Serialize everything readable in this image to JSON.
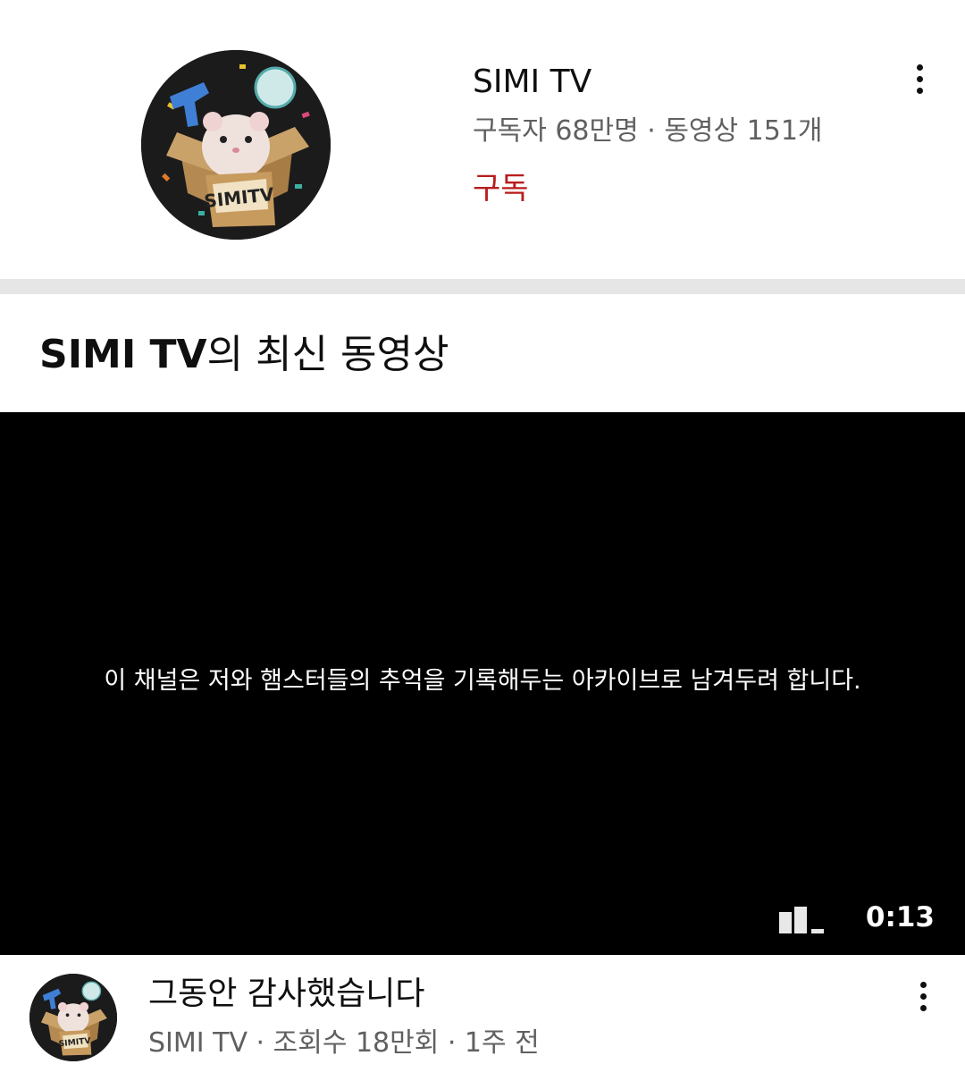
{
  "channel": {
    "name": "SIMI TV",
    "stats": "구독자 68만명 · 동영상 151개",
    "subscribe_label": "구독",
    "avatar_text": "SIMITV"
  },
  "latest": {
    "title_bold": "SIMI TV",
    "title_rest": "의 최신 동영상"
  },
  "player": {
    "overlay_text": "이 채널은 저와 햄스터들의 추억을 기록해두는 아카이브로 남겨두려 합니다.",
    "duration": "0:13"
  },
  "video": {
    "title": "그동안 감사했습니다",
    "meta": "SIMI TV · 조회수 18만회 · 1주 전",
    "avatar_text": "SIMITV"
  },
  "colors": {
    "subscribe": "#b81c1c",
    "secondary_text": "#606060",
    "separator": "#e6e6e6",
    "player_bg": "#000000"
  },
  "icons": [
    "more-vert-icon",
    "bars-icon"
  ]
}
